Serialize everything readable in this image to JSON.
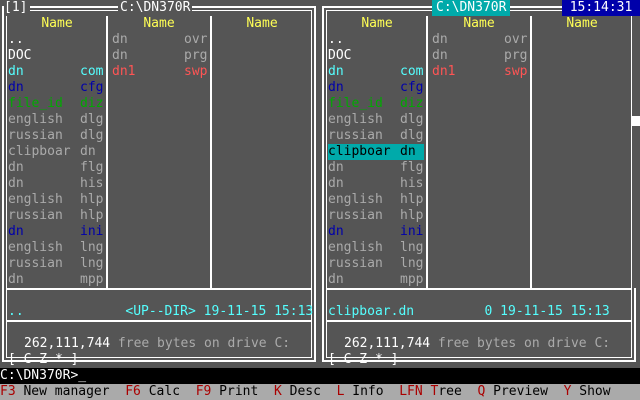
{
  "left_panel": {
    "title": "[1]",
    "path": "C:\\DN370R",
    "columns": [
      "Name",
      "Name",
      "Name"
    ],
    "col1": [
      {
        "name": "..",
        "ext": "",
        "color": "white"
      },
      {
        "name": "DOC",
        "ext": "",
        "color": "white"
      },
      {
        "name": "dn",
        "ext": "com",
        "color": "cyan"
      },
      {
        "name": "dn",
        "ext": "cfg",
        "color": "blue"
      },
      {
        "name": "file_id",
        "ext": "diz",
        "color": "green"
      },
      {
        "name": "english",
        "ext": "dlg",
        "color": "gray"
      },
      {
        "name": "russian",
        "ext": "dlg",
        "color": "gray"
      },
      {
        "name": "clipboar",
        "ext": "dn",
        "color": "gray"
      },
      {
        "name": "dn",
        "ext": "flg",
        "color": "gray"
      },
      {
        "name": "dn",
        "ext": "his",
        "color": "gray"
      },
      {
        "name": "english",
        "ext": "hlp",
        "color": "gray"
      },
      {
        "name": "russian",
        "ext": "hlp",
        "color": "gray"
      },
      {
        "name": "dn",
        "ext": "ini",
        "color": "blue"
      },
      {
        "name": "english",
        "ext": "lng",
        "color": "gray"
      },
      {
        "name": "russian",
        "ext": "lng",
        "color": "gray"
      },
      {
        "name": "dn",
        "ext": "mpp",
        "color": "gray"
      }
    ],
    "col2": [
      {
        "name": "dn",
        "ext": "ovr",
        "color": "gray"
      },
      {
        "name": "dn",
        "ext": "prg",
        "color": "gray"
      },
      {
        "name": "dn1",
        "ext": "swp",
        "color": "red"
      }
    ],
    "status": "..             <UP--DIR> 19-11-15 15:13",
    "free": "262,111,744",
    "free_text": " free bytes on drive C:",
    "drives": "[ C Z * ]"
  },
  "right_panel": {
    "path": "C:\\DN370R",
    "columns": [
      "Name",
      "Name",
      "Name"
    ],
    "col1": [
      {
        "name": "..",
        "ext": "",
        "color": "white"
      },
      {
        "name": "DOC",
        "ext": "",
        "color": "white"
      },
      {
        "name": "dn",
        "ext": "com",
        "color": "cyan"
      },
      {
        "name": "dn",
        "ext": "cfg",
        "color": "blue"
      },
      {
        "name": "file_id",
        "ext": "diz",
        "color": "green"
      },
      {
        "name": "english",
        "ext": "dlg",
        "color": "gray"
      },
      {
        "name": "russian",
        "ext": "dlg",
        "color": "gray"
      },
      {
        "name": "clipboar",
        "ext": "dn",
        "color": "cursor"
      },
      {
        "name": "dn",
        "ext": "flg",
        "color": "gray"
      },
      {
        "name": "dn",
        "ext": "his",
        "color": "gray"
      },
      {
        "name": "english",
        "ext": "hlp",
        "color": "gray"
      },
      {
        "name": "russian",
        "ext": "hlp",
        "color": "gray"
      },
      {
        "name": "dn",
        "ext": "ini",
        "color": "blue"
      },
      {
        "name": "english",
        "ext": "lng",
        "color": "gray"
      },
      {
        "name": "russian",
        "ext": "lng",
        "color": "gray"
      },
      {
        "name": "dn",
        "ext": "mpp",
        "color": "gray"
      }
    ],
    "col2": [
      {
        "name": "dn",
        "ext": "ovr",
        "color": "gray"
      },
      {
        "name": "dn",
        "ext": "prg",
        "color": "gray"
      },
      {
        "name": "dn1",
        "ext": "swp",
        "color": "red"
      }
    ],
    "status": "clipboar.dn         0 19-11-15 15:13",
    "free": "262,111,744",
    "free_text": " free bytes on drive C:",
    "drives": "[ C Z * ]"
  },
  "clock": "15:14:31",
  "prompt": "C:\\DN370R>_",
  "keybar": [
    {
      "key": "F3",
      "label": " New manager "
    },
    {
      "key": "F6",
      "label": " Calc "
    },
    {
      "key": "F9",
      "label": " Print "
    },
    {
      "key": "K",
      "label": " Desc "
    },
    {
      "key": "L",
      "label": " Info "
    },
    {
      "key": "LFN",
      "label": " "
    },
    {
      "key": "T",
      "label": "ree "
    },
    {
      "key": "Q",
      "label": " Preview "
    },
    {
      "key": "Y",
      "label": " Show"
    }
  ],
  "colors": {
    "panel_bg": "#555555",
    "cursor": "#00aaaa",
    "clock_bg": "#0000aa",
    "keybar_bg": "#aaaaaa"
  }
}
